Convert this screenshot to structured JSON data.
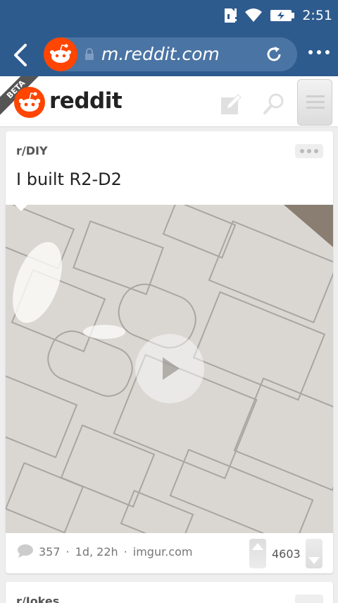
{
  "status_bar": {
    "time": "2:51"
  },
  "browser": {
    "url": "m.reddit.com"
  },
  "header": {
    "wordmark": "reddit",
    "beta_label": "BETA"
  },
  "post": {
    "subreddit": "r/DIY",
    "title": "I built R2-D2",
    "comments": "357",
    "age": "1d, 22h",
    "domain": "imgur.com",
    "score": "4603",
    "separator": "·"
  },
  "next_post": {
    "subreddit": "r/Jokes"
  },
  "colors": {
    "bar": "#2e5b8e",
    "reddit_orange": "#ff4500"
  }
}
